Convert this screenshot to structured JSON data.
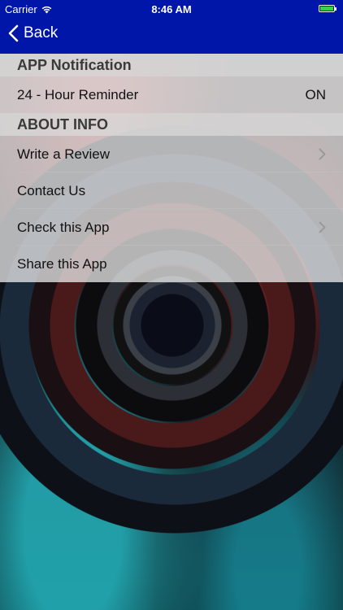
{
  "status_bar": {
    "carrier": "Carrier",
    "time": "8:46 AM",
    "icons": [
      "wifi-icon",
      "battery-icon"
    ],
    "battery_color": "#33d14c"
  },
  "nav": {
    "back_label": "Back",
    "bar_color": "#0016a8"
  },
  "sections": {
    "app_notification": {
      "title": "APP Notification",
      "reminder": {
        "label": "24 - Hour Reminder",
        "value": "ON"
      }
    },
    "about_info": {
      "title": "ABOUT INFO",
      "items": [
        {
          "label": "Write a Review",
          "has_chevron": true
        },
        {
          "label": "Contact Us",
          "has_chevron": false
        },
        {
          "label": "Check this App",
          "has_chevron": true
        },
        {
          "label": "Share this App",
          "has_chevron": false
        }
      ]
    }
  }
}
